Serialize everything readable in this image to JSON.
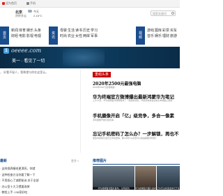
{
  "topbar": {
    "set_home": "设为首页",
    "mobile": "手机"
  },
  "weather": {
    "city": "北京",
    "sub": "阴转多云",
    "desc_line1": "今天",
    "desc_line2": "2-16°C"
  },
  "search": {
    "placeholder": "搜索关键词"
  },
  "nav_groups": [
    {
      "badge": [
        "首",
        "页"
      ],
      "links": [
        "新闻",
        "体育",
        "娱乐",
        "头条",
        "财经",
        "电影",
        "影视",
        "电视"
      ]
    },
    {
      "badge": [
        "资",
        "讯"
      ],
      "links": [
        "母婴",
        "生活",
        "读书",
        "历史",
        "学习",
        "时尚",
        "农业",
        "女性",
        "两岸",
        "军事"
      ]
    },
    {
      "badge": [
        "视",
        "频"
      ],
      "links": [
        "游戏",
        "图库",
        "彩票",
        "买车",
        "音乐",
        "娱乐",
        "理财",
        "旅游"
      ]
    }
  ],
  "banner": {
    "logo": "1",
    "title": "oeeee.com",
    "subtitle": "美一 · 看见了一切"
  },
  "info_line": "， 好看不轻人，我希望与你在这里认。",
  "hot_tag": "重组头条",
  "news": [
    {
      "title": "2020年2500元最强电脑",
      "summary": "2020年2500元最强电脑..."
    },
    {
      "title": "华为终端官方微博爆出最新鸿蒙华为笔记",
      "summary": "上午14点，华为终端官方微博发布了一则最新消息，鸿蒙系统将会在笔记本电脑上使用..."
    },
    {
      "title": "手机摄像开启「亿」级竞争，多合一像素",
      "summary": "手机摄像开启亿级竞争..."
    },
    {
      "title": "忘记手机密码了怎么办？一步解锁，再也不",
      "summary": "很多时候我们会忘记手机密码，那么有什么办法可以快速解锁手机呢？"
    }
  ],
  "sidebar": {
    "heading": "最新",
    "more": "更多 »",
    "items": [
      "· 这样保养睫毛更漂亮，你就",
      "· 这种检查方法你要了解一下",
      "· 不用担心了减肥秘诀 关于全部",
      "· 办公室十大习惯要改掉",
      "· 教程上手: 136家好吃"
    ]
  },
  "recommend": {
    "title": "推荐图片",
    "thumbs": [
      "华为终端官方图片发布，今年系列",
      "华为终端官方图片发布，今年系列",
      "艾尔莎全新首发你们于此"
    ]
  }
}
